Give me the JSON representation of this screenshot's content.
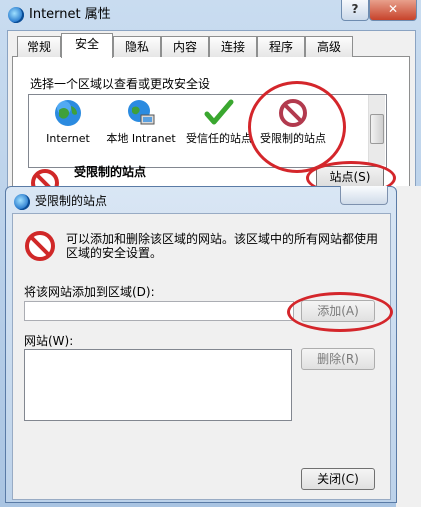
{
  "window": {
    "title": "Internet 属性",
    "help_label": "?",
    "close_label": "✕"
  },
  "tabs": [
    {
      "label": "常规"
    },
    {
      "label": "安全"
    },
    {
      "label": "隐私"
    },
    {
      "label": "内容"
    },
    {
      "label": "连接"
    },
    {
      "label": "程序"
    },
    {
      "label": "高级"
    }
  ],
  "security": {
    "prompt": "选择一个区域以查看或更改安全设",
    "zones": [
      {
        "label": "Internet",
        "icon": "globe-icon"
      },
      {
        "label": "本地 Intranet",
        "icon": "intranet-icon"
      },
      {
        "label": "受信任的站点",
        "icon": "checkmark-icon"
      },
      {
        "label": "受限制的站点",
        "icon": "restricted-icon"
      }
    ],
    "selected_heading": "受限制的站点",
    "sites_button": "站点(S)"
  },
  "dialog": {
    "title": "受限制的站点",
    "info_text": "可以添加和删除该区域的网站。该区域中的所有网站都使用区域的安全设置。",
    "add_label": "将该网站添加到区域(D):",
    "add_value": "",
    "add_button": "添加(A)",
    "sites_label": "网站(W):",
    "remove_button": "删除(R)",
    "close_button": "关闭(C)"
  },
  "colors": {
    "highlight_circle": "#d4262b",
    "accent": "#1b6fc8"
  }
}
